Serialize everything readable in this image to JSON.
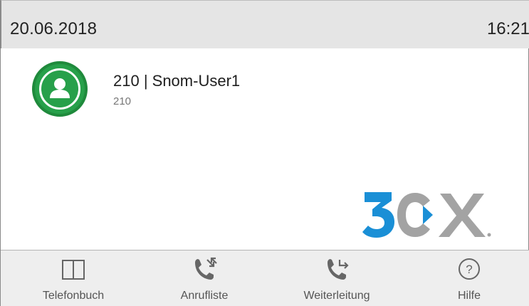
{
  "status_bar": {
    "date": "20.06.2018",
    "time": "16:21"
  },
  "account": {
    "title": "210 | Snom-User1",
    "subtitle": "210",
    "avatar_color": "#27a04a"
  },
  "logo": {
    "text": "3CX",
    "blue": "#1a8fd6",
    "gray": "#a3a3a3"
  },
  "softkeys": [
    {
      "label": "Telefonbuch",
      "icon": "book-icon"
    },
    {
      "label": "Anrufliste",
      "icon": "call-list-icon"
    },
    {
      "label": "Weiterleitung",
      "icon": "call-forward-icon"
    },
    {
      "label": "Hilfe",
      "icon": "help-icon"
    }
  ]
}
